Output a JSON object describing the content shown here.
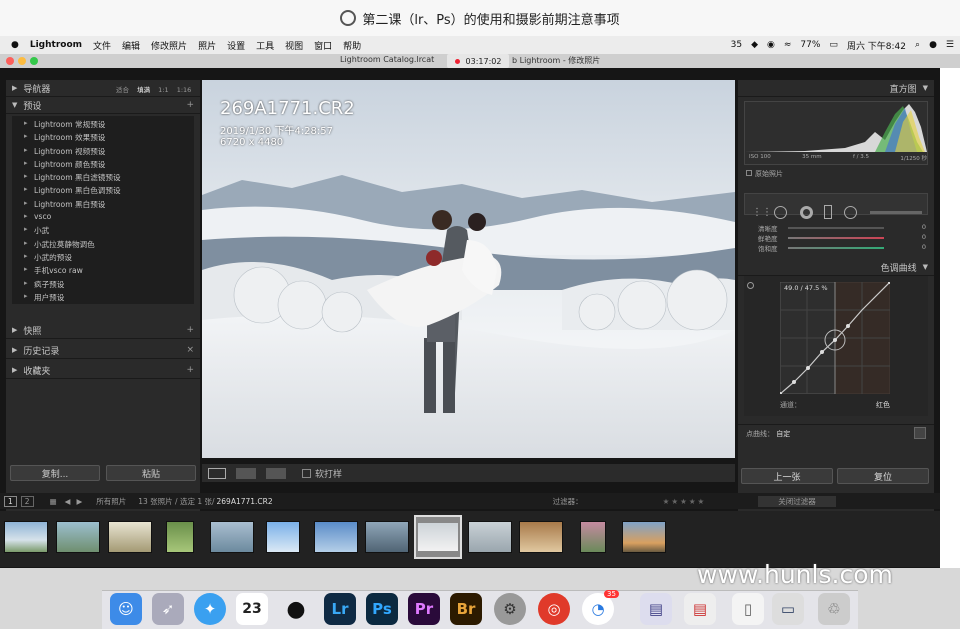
{
  "window_title": "第二课（lr、Ps）的使用和摄影前期注意事项",
  "menubar": {
    "apple": "",
    "items": [
      "Lightroom",
      "文件",
      "编辑",
      "修改照片",
      "照片",
      "设置",
      "工具",
      "视图",
      "窗口",
      "帮助"
    ],
    "status": [
      "35",
      "77%",
      "周六 下午8:42"
    ]
  },
  "winbar": {
    "catalog": "Lightroom Catalog.lrcat",
    "module": "b Lightroom - 修改照片",
    "recording_time": "03:17:02"
  },
  "left": {
    "navigator": {
      "label": "导航器",
      "zoom": [
        "适合",
        "填满",
        "1:1",
        "1:16"
      ]
    },
    "presets": {
      "label": "预设",
      "items": [
        "Lightroom 常规预设",
        "Lightroom 效果预设",
        "Lightroom 视频预设",
        "Lightroom 颜色预设",
        "Lightroom 黑白滤镜预设",
        "Lightroom 黑白色调预设",
        "Lightroom 黑白预设",
        "vsco",
        "小武",
        "小武拉莫静物调色",
        "小武的预设",
        "手机vsco raw",
        "疯子预设",
        "用户预设"
      ]
    },
    "snapshots": "快照",
    "history": "历史记录",
    "collections": "收藏夹",
    "copy_btn": "复制...",
    "paste_btn": "粘贴"
  },
  "photo": {
    "filename": "269A1771.CR2",
    "datetime": "2019/1/30 下午4:28:57",
    "dimensions": "6720 x 4480"
  },
  "toolbar": {
    "softproof": "软打样"
  },
  "right": {
    "histogram_label": "直方图",
    "exif": [
      "ISO 100",
      "35 mm",
      "f / 3.5",
      "1/1250 秒"
    ],
    "original_photo": "原始照片",
    "sliders": [
      {
        "label": "清晰度",
        "value": "0"
      },
      {
        "label": "鲜艳度",
        "value": "0"
      },
      {
        "label": "饱和度",
        "value": "0"
      }
    ],
    "tone_curve_label": "色调曲线",
    "curve_readout": "49.0 / 47.5 %",
    "channel_label": "通道：",
    "channel_value": "红色",
    "point_curve_label": "点曲线：",
    "point_curve_value": "自定",
    "prev_btn": "上一张",
    "reset_btn": "复位"
  },
  "filmbar": {
    "page1": "1",
    "page2": "2",
    "source": "所有照片",
    "count": "13 张照片 / 选定 1 张/",
    "selected_file": "269A1771.CR2",
    "filter_label": "过滤器：",
    "filter_value": "关闭过滤器"
  },
  "dock": {
    "calendar_day": "23",
    "badge": "35"
  },
  "watermark": "www.hunls.com",
  "colors": {
    "accent": "#4a90d9",
    "lr_bg": "#161616"
  }
}
